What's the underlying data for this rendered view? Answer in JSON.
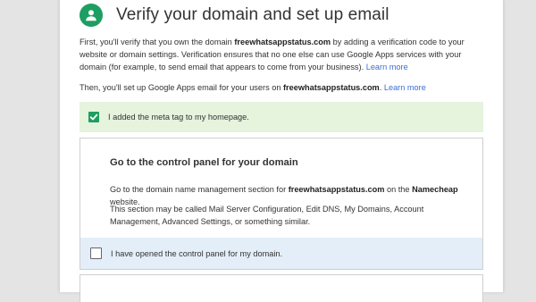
{
  "header": {
    "title": "Verify your domain and set up email",
    "icon": "person-icon",
    "icon_color": "#1e9e61"
  },
  "intro": {
    "p1_a": "First, you'll verify that you own the domain ",
    "p1_domain": "freewhatsappstatus.com",
    "p1_b": " by adding a verification code to your website or domain settings. Verification ensures that no one else can use Google Apps services with your domain (for example, to send email that appears to come from your business). ",
    "p1_link": "Learn more",
    "p2_a": "Then, you'll set up Google Apps email for your users on ",
    "p2_domain": "freewhatsappstatus.com",
    "p2_b": ". ",
    "p2_link": "Learn more"
  },
  "meta_tag_check": {
    "label": "I added the meta tag to my homepage.",
    "checked": true
  },
  "step": {
    "title": "Go to the control panel for your domain",
    "text1_a": "Go to the domain name management section for ",
    "text1_domain": "freewhatsappstatus.com",
    "text1_b": " on the ",
    "text1_registrar": "Namecheap",
    "text1_c": " website.",
    "text2": "This section may be called Mail Server Configuration, Edit DNS, My Domains, Account Management, Advanced Settings, or something similar.",
    "confirm_label": "I have opened the control panel for my domain.",
    "confirm_checked": false
  },
  "colors": {
    "accent_green": "#1e9e61",
    "success_bg": "#e6f3dd",
    "info_bg": "#e3eef9",
    "link": "#3b6fd4"
  }
}
